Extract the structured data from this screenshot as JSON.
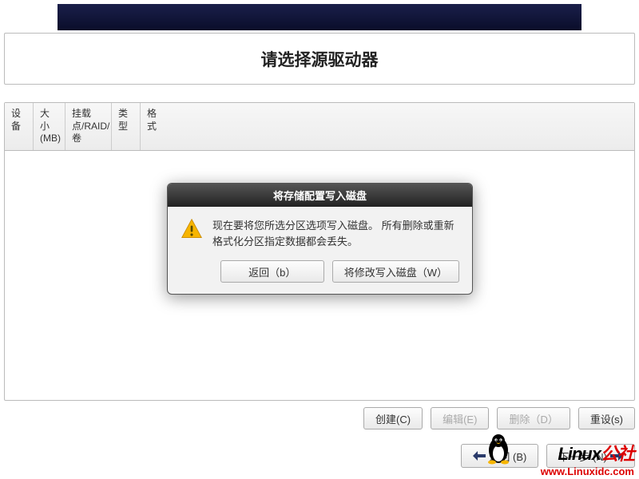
{
  "header": {
    "title": "请选择源驱动器"
  },
  "table": {
    "columns": {
      "device": "设备",
      "size": "大小(MB)",
      "mount": "挂载点/RAID/卷",
      "type": "类型",
      "format": "格式"
    },
    "rows": []
  },
  "actions": {
    "create": "创建(C)",
    "edit": "编辑(E)",
    "delete": "删除（D）",
    "reset": "重设(s)"
  },
  "nav": {
    "back": "返回 (B)",
    "next": "下一步 (N)"
  },
  "dialog": {
    "title": "将存储配置写入磁盘",
    "message": "现在要将您所选分区选项写入磁盘。 所有删除或重新格式化分区指定数据都会丢失。",
    "back": "返回（b）",
    "write": "将修改写入磁盘（W）"
  },
  "watermark": {
    "brand_prefix": "Linux",
    "brand_suffix": "公社",
    "url": "www.Linuxidc.com"
  }
}
